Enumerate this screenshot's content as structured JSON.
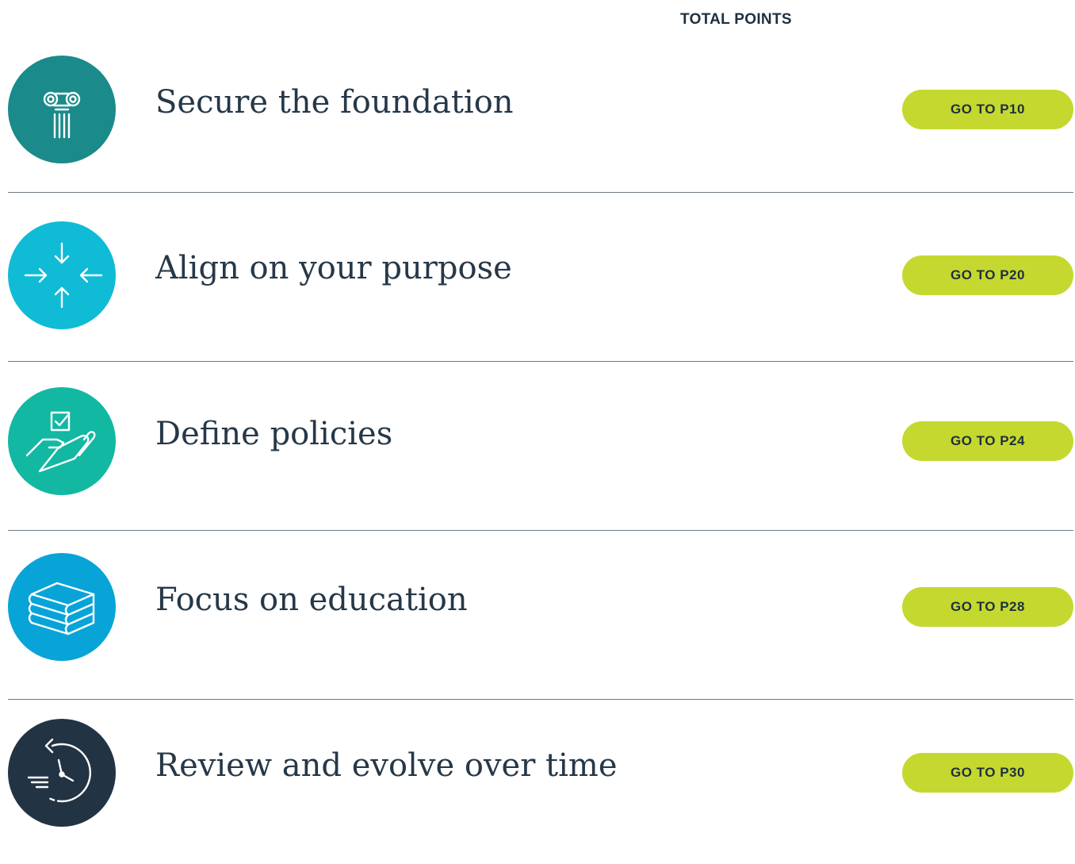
{
  "header": {
    "total_points_label": "TOTAL POINTS"
  },
  "rows": [
    {
      "title": "Secure the foundation",
      "button": "GO TO P10",
      "icon": "pillar-icon",
      "color": "#1b8a8a"
    },
    {
      "title": "Align on your purpose",
      "button": "GO TO P20",
      "icon": "converging-arrows-icon",
      "color": "#10bbd6"
    },
    {
      "title": "Define policies",
      "button": "GO TO P24",
      "icon": "hand-checkbox-icon",
      "color": "#12b8a2"
    },
    {
      "title": "Focus on education",
      "button": "GO TO P28",
      "icon": "books-icon",
      "color": "#08a4d8"
    },
    {
      "title": "Review and evolve over time",
      "button": "GO TO P30",
      "icon": "clock-review-icon",
      "color": "#223344"
    }
  ],
  "colors": {
    "button": "#c5d82f",
    "text": "#263848",
    "divider": "#6f7a84"
  }
}
